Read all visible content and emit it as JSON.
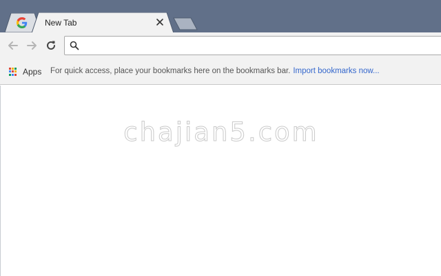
{
  "tabs": {
    "pinned": {
      "favicon": "google-g-icon"
    },
    "active": {
      "title": "New Tab",
      "close_icon": "close-icon"
    },
    "new_tab_icon": "new-tab-icon"
  },
  "toolbar": {
    "back_icon": "back-arrow-icon",
    "forward_icon": "forward-arrow-icon",
    "reload_icon": "reload-icon",
    "omnibox": {
      "value": "",
      "placeholder": "",
      "icon": "search-icon"
    }
  },
  "bookmarks_bar": {
    "apps_label": "Apps",
    "hint_text": "For quick access, place your bookmarks here on the bookmarks bar.",
    "import_link": "Import bookmarks now..."
  },
  "watermark": "chajian5.com",
  "colors": {
    "tabstrip": "#617089",
    "toolbar": "#f2f2f2",
    "link": "#3366cc",
    "apps_grid": [
      "#db4437",
      "#f4b400",
      "#0f9d58",
      "#4285f4",
      "#db4437",
      "#f4b400",
      "#0f9d58",
      "#4285f4",
      "#db4437"
    ]
  }
}
